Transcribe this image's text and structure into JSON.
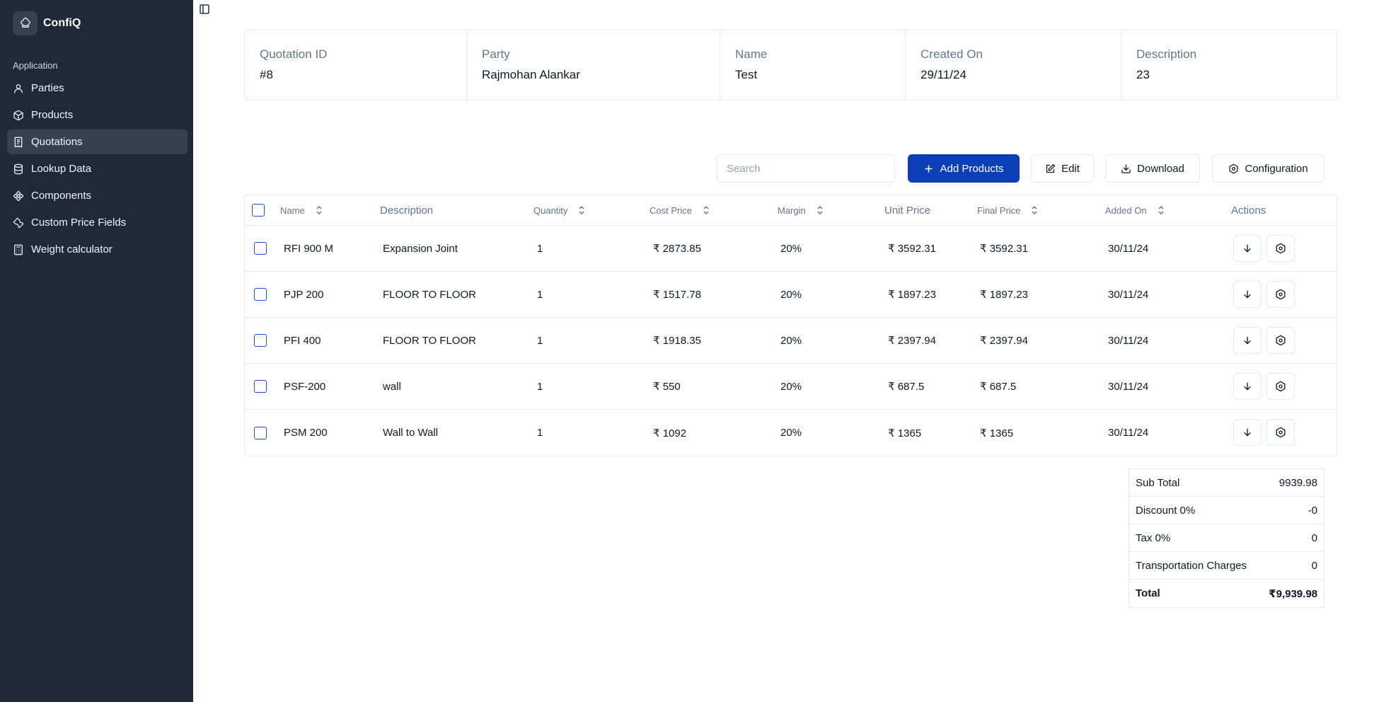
{
  "app": {
    "name": "ConfiQ",
    "logo_icon": "chef-hat-icon"
  },
  "sidebar": {
    "group_label": "Application",
    "items": [
      {
        "label": "Parties",
        "icon": "user-icon",
        "active": false
      },
      {
        "label": "Products",
        "icon": "box-icon",
        "active": false
      },
      {
        "label": "Quotations",
        "icon": "receipt-icon",
        "active": true
      },
      {
        "label": "Lookup Data",
        "icon": "database-icon",
        "active": false
      },
      {
        "label": "Components",
        "icon": "components-icon",
        "active": false
      },
      {
        "label": "Custom Price Fields",
        "icon": "wrench-icon",
        "active": false
      },
      {
        "label": "Weight calculator",
        "icon": "calculator-icon",
        "active": false
      }
    ]
  },
  "quotation": {
    "id_label": "Quotation ID",
    "id": "#8",
    "party_label": "Party",
    "party": "Rajmohan Alankar",
    "name_label": "Name",
    "name": "Test",
    "created_label": "Created On",
    "created": "29/11/24",
    "description_label": "Description",
    "description": "23"
  },
  "toolbar": {
    "search_placeholder": "Search",
    "add_products": "Add Products",
    "edit": "Edit",
    "download": "Download",
    "configuration": "Configuration"
  },
  "table": {
    "columns": {
      "name": "Name",
      "description": "Description",
      "quantity": "Quantity",
      "cost_price": "Cost Price",
      "margin": "Margin",
      "unit_price": "Unit Price",
      "final_price": "Final Price",
      "added_on": "Added On",
      "actions": "Actions"
    },
    "rows": [
      {
        "name": "RFI 900 M",
        "description": "Expansion Joint",
        "quantity": "1",
        "cost_price": "₹ 2873.85",
        "margin": "20%",
        "unit_price": "₹ 3592.31",
        "final_price": "₹ 3592.31",
        "added_on": "30/11/24"
      },
      {
        "name": "PJP 200",
        "description": "FLOOR TO FLOOR",
        "quantity": "1",
        "cost_price": "₹ 1517.78",
        "margin": "20%",
        "unit_price": "₹ 1897.23",
        "final_price": "₹ 1897.23",
        "added_on": "30/11/24"
      },
      {
        "name": "PFI 400",
        "description": "FLOOR TO FLOOR",
        "quantity": "1",
        "cost_price": "₹ 1918.35",
        "margin": "20%",
        "unit_price": "₹ 2397.94",
        "final_price": "₹ 2397.94",
        "added_on": "30/11/24"
      },
      {
        "name": "PSF-200",
        "description": "wall",
        "quantity": "1",
        "cost_price": "₹ 550",
        "margin": "20%",
        "unit_price": "₹ 687.5",
        "final_price": "₹ 687.5",
        "added_on": "30/11/24"
      },
      {
        "name": "PSM 200",
        "description": "Wall to Wall",
        "quantity": "1",
        "cost_price": "₹ 1092",
        "margin": "20%",
        "unit_price": "₹ 1365",
        "final_price": "₹ 1365",
        "added_on": "30/11/24"
      }
    ]
  },
  "totals": [
    {
      "label": "Sub Total",
      "value": "9939.98"
    },
    {
      "label": "Discount 0%",
      "value": "-0"
    },
    {
      "label": "Tax 0%",
      "value": "0"
    },
    {
      "label": "Transportation Charges",
      "value": "0"
    },
    {
      "label": "Total",
      "value": "₹9,939.98"
    }
  ],
  "colors": {
    "sidebar_bg": "#1f2937",
    "primary": "#0b3fb8",
    "checkbox": "#1d4ed8"
  }
}
